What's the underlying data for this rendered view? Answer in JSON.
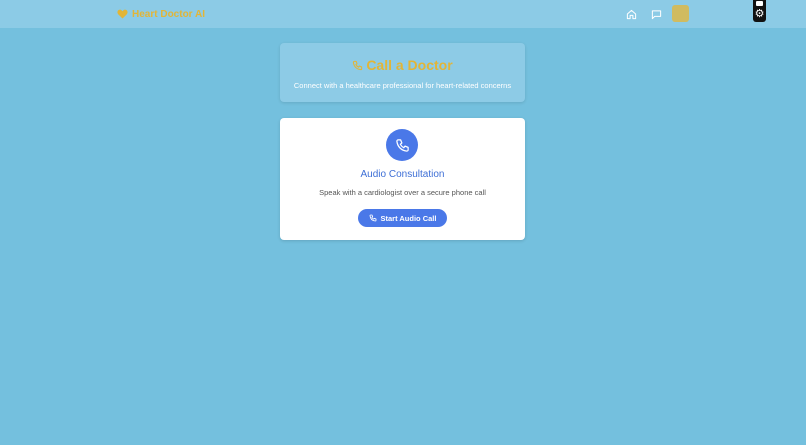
{
  "app": {
    "brand": "Heart Doctor AI",
    "icons": {
      "brand": "heart-icon",
      "home": "home-icon",
      "chat": "chat-icon",
      "settings": "gear-icon"
    }
  },
  "header": {
    "title": "Call a Doctor",
    "subtitle": "Connect with a healthcare professional for heart-related concerns",
    "icon": "phone-icon"
  },
  "consultation": {
    "title": "Audio Consultation",
    "description": "Speak with a cardiologist over a secure phone call",
    "button_label": "Start Audio Call",
    "icon": "phone-icon"
  },
  "colors": {
    "background": "#74c0de",
    "topbar": "#8ccbe6",
    "brand": "#e2b537",
    "accent": "#4a78e8",
    "avatar": "#d0bb60"
  }
}
